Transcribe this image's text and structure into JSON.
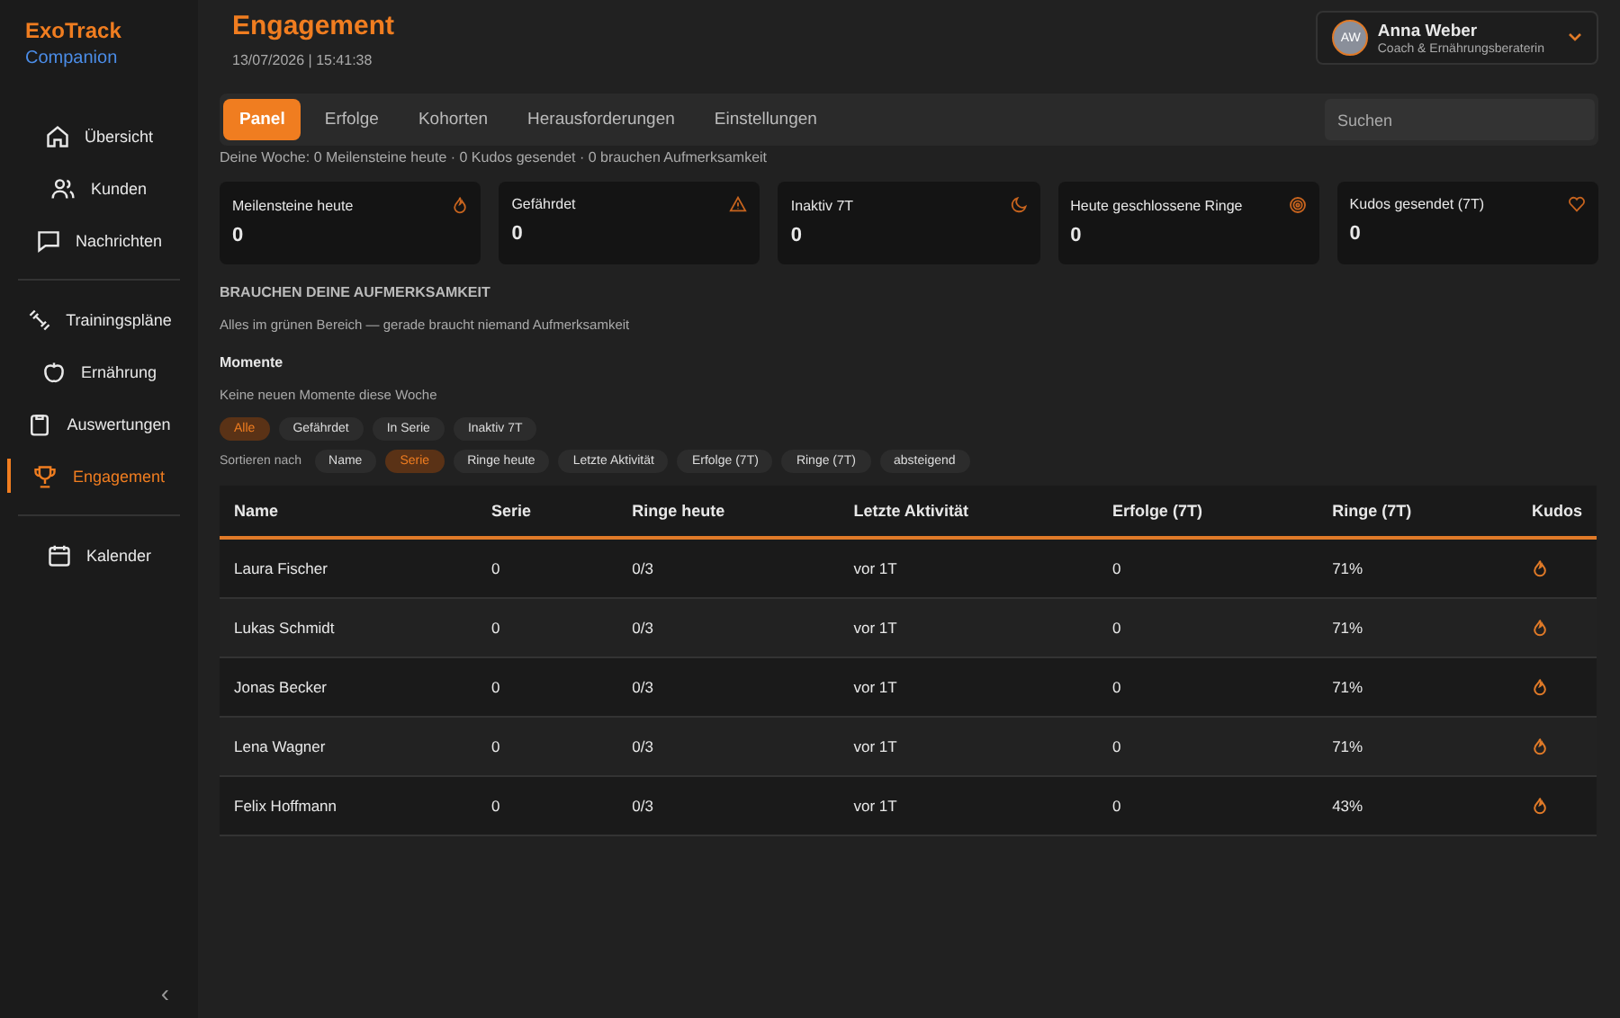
{
  "brand": {
    "name": "ExoTrack",
    "sub": "Companion"
  },
  "sidebar": {
    "groups": [
      [
        {
          "label": "Übersicht",
          "selected": false
        },
        {
          "label": "Kunden",
          "selected": false
        },
        {
          "label": "Nachrichten",
          "selected": false
        }
      ],
      [
        {
          "label": "Trainingspläne",
          "selected": false
        },
        {
          "label": "Ernährung",
          "selected": false
        },
        {
          "label": "Auswertungen",
          "selected": false
        },
        {
          "label": "Engagement",
          "selected": true
        }
      ],
      [
        {
          "label": "Kalender",
          "selected": false
        }
      ]
    ],
    "collapse": "‹"
  },
  "header": {
    "title": "Engagement",
    "datetime": "13/07/2026 | 15:41:38"
  },
  "user": {
    "initials": "AW",
    "name": "Anna Weber",
    "role": "Coach & Ernährungsberaterin"
  },
  "tabs": [
    {
      "label": "Panel",
      "selected": true
    },
    {
      "label": "Erfolge",
      "selected": false
    },
    {
      "label": "Kohorten",
      "selected": false
    },
    {
      "label": "Herausforderungen",
      "selected": false
    },
    {
      "label": "Einstellungen",
      "selected": false
    }
  ],
  "search": {
    "placeholder": "Suchen"
  },
  "summary": "Deine Woche: 0 Meilensteine heute · 0 Kudos gesendet · 0 brauchen Aufmerksamkeit",
  "stats": [
    {
      "label": "Meilensteine heute",
      "value": "0"
    },
    {
      "label": "Gefährdet",
      "value": "0"
    },
    {
      "label": "Inaktiv 7T",
      "value": "0"
    },
    {
      "label": "Heute geschlossene Ringe",
      "value": "0"
    },
    {
      "label": "Kudos gesendet (7T)",
      "value": "0"
    }
  ],
  "attention": {
    "heading": "BRAUCHEN DEINE AUFMERKSAMKEIT",
    "text": "Alles im grünen Bereich — gerade braucht niemand Aufmerksamkeit"
  },
  "moments": {
    "heading": "Momente",
    "text": "Keine neuen Momente diese Woche"
  },
  "filters": [
    {
      "label": "Alle",
      "selected": true
    },
    {
      "label": "Gefährdet",
      "selected": false
    },
    {
      "label": "In Serie",
      "selected": false
    },
    {
      "label": "Inaktiv 7T",
      "selected": false
    }
  ],
  "sort": {
    "label": "Sortieren nach",
    "options": [
      {
        "label": "Name",
        "selected": false
      },
      {
        "label": "Serie",
        "selected": true
      },
      {
        "label": "Ringe heute",
        "selected": false
      },
      {
        "label": "Letzte Aktivität",
        "selected": false
      },
      {
        "label": "Erfolge (7T)",
        "selected": false
      },
      {
        "label": "Ringe (7T)",
        "selected": false
      },
      {
        "label": "absteigend",
        "selected": false
      }
    ]
  },
  "table": {
    "columns": [
      "Name",
      "Serie",
      "Ringe heute",
      "Letzte Aktivität",
      "Erfolge (7T)",
      "Ringe (7T)",
      "Kudos"
    ],
    "rows": [
      [
        "Laura Fischer",
        "0",
        "0/3",
        "vor 1T",
        "0",
        "71%"
      ],
      [
        "Lukas Schmidt",
        "0",
        "0/3",
        "vor 1T",
        "0",
        "71%"
      ],
      [
        "Jonas Becker",
        "0",
        "0/3",
        "vor 1T",
        "0",
        "71%"
      ],
      [
        "Lena Wagner",
        "0",
        "0/3",
        "vor 1T",
        "0",
        "71%"
      ],
      [
        "Felix Hoffmann",
        "0",
        "0/3",
        "vor 1T",
        "0",
        "43%"
      ]
    ]
  }
}
